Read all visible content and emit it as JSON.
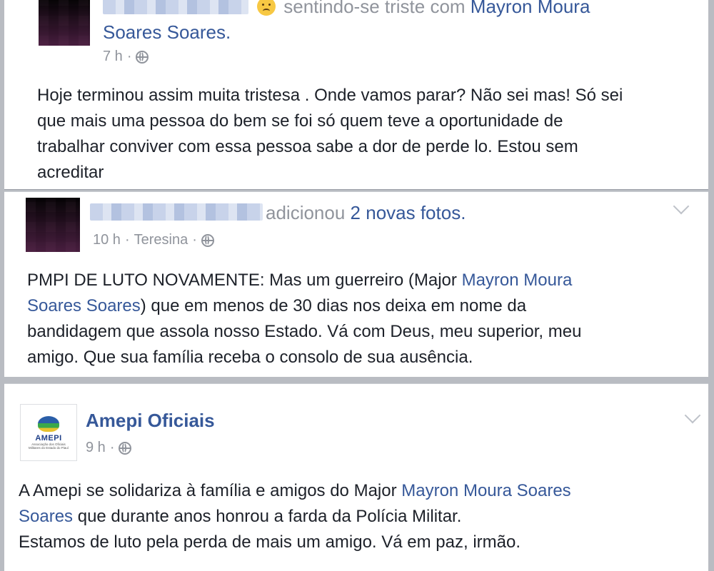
{
  "post1": {
    "feeling_text": "sentindo-se triste com",
    "tagged_name_line1": "Mayron Moura",
    "tagged_name_line2": "Soares Soares.",
    "time": "7 h",
    "body_lines": [
      "Hoje terminou assim muita tristesa . Onde vamos parar? Não sei mas! Só sei",
      "que mais uma pessoa do bem se foi só quem teve a oportunidade de",
      "trabalhar conviver com essa pessoa sabe a dor de perde lo. Estou sem",
      "acreditar"
    ]
  },
  "post2": {
    "action_text": "adicionou",
    "photos_link": "2 novas fotos.",
    "time": "10 h",
    "location": "Teresina",
    "body": {
      "line1_prefix": "PMPI DE LUTO NOVAMENTE: Mas um guerreiro (Major ",
      "line1_link": "Mayron Moura",
      "line2_link": "Soares Soares",
      "line2_suffix": ") que em menos de 30 dias nos deixa em nome da",
      "line3": "bandidagem que assola nosso Estado. Vá com Deus, meu superior, meu",
      "line4": "amigo. Que sua família receba o consolo de sua ausência."
    }
  },
  "post3": {
    "page_name": "Amepi Oficiais",
    "logo_text": "AMEPI",
    "logo_subtext": "Associação dos Oficiais Militares do Estado do Piauí",
    "time": "9 h",
    "body": {
      "line1_prefix": "A Amepi se solidariza à família e amigos do Major ",
      "line1_link": "Mayron Moura Soares",
      "line2_link": "Soares",
      "line2_suffix": " que durante anos honrou a farda da Polícia Militar.",
      "line3": "Estamos de luto pela perda de mais um amigo. Vá em paz, irmão."
    }
  },
  "icons": {
    "privacy": "globe-icon",
    "menu": "chevron-down-icon",
    "feeling": "sad-face-icon"
  },
  "colors": {
    "link": "#365899",
    "meta": "#90949c",
    "text": "#1d2129",
    "background": "#b9bcc2"
  }
}
